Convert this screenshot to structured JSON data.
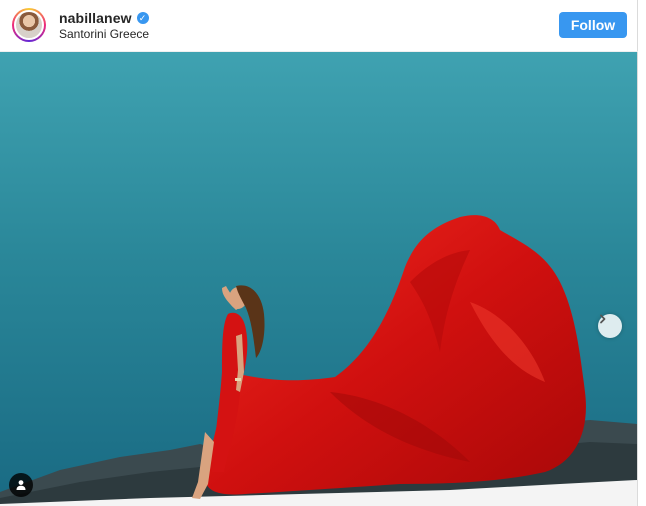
{
  "post": {
    "username": "nabillanew",
    "location": "Santorini Greece",
    "follow_label": "Follow",
    "verified": true,
    "colors": {
      "accent": "#3897f0",
      "username_text": "#262626",
      "dress_red": "#d81414",
      "sky_teal": "#2f8e9f"
    }
  },
  "icons": {
    "verified": "verified-badge-icon",
    "next": "chevron-right-icon",
    "tagged": "user-tag-icon"
  }
}
